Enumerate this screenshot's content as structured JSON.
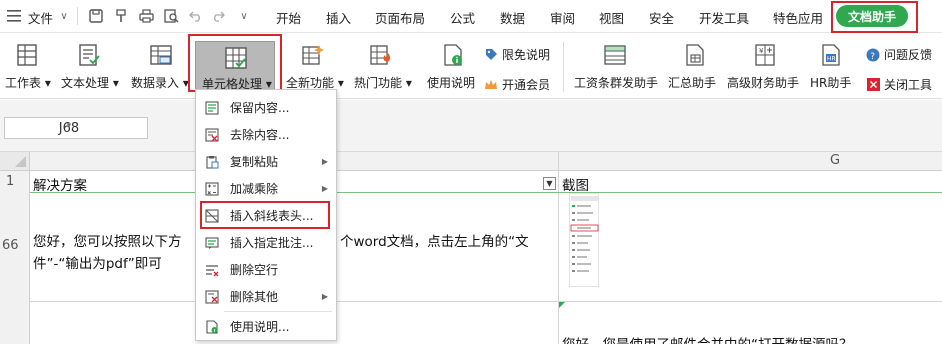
{
  "menubar": {
    "file_label": "文件",
    "tabs": [
      "开始",
      "插入",
      "页面布局",
      "公式",
      "数据",
      "审阅",
      "视图",
      "安全",
      "开发工具",
      "特色应用"
    ],
    "active_tab": "文档助手",
    "accent_color": "#2fa84f",
    "highlight_color": "#d9232d"
  },
  "ribbon": {
    "worksheet": "工作表",
    "text_processing": "文本处理",
    "data_entry": "数据录入",
    "cell_processing": "单元格处理",
    "all_features": "全新功能",
    "hot_features": "热门功能",
    "usage_guide": "使用说明",
    "disclaimer": "限免说明",
    "open_membership": "开通会员",
    "payroll_sender": "工资条群发助手",
    "summary_assistant": "汇总助手",
    "finance_assistant": "高级财务助手",
    "hr_assistant": "HR助手",
    "feedback": "问题反馈",
    "close_tool": "关闭工具"
  },
  "formula_bar": {
    "name_box": "J68"
  },
  "grid": {
    "col_g_header": "G",
    "row1_header": "1",
    "row66_header": "66",
    "a1": "解决方案",
    "g1": "截图",
    "a66_line1_left": "您好，您可以按照以下方",
    "a66_line1_right": "个word文档，点击左上角的“文",
    "a66_line2": "件”-“输出为pdf”即可",
    "g_next": "您好，您是使用了邮件合并中的“打开数据源吗？"
  },
  "dropdown": {
    "items": [
      {
        "label": "保留内容...",
        "submenu": false
      },
      {
        "label": "去除内容...",
        "submenu": false
      },
      {
        "label": "复制粘贴",
        "submenu": true
      },
      {
        "label": "加减乘除",
        "submenu": true
      },
      {
        "label": "插入斜线表头...",
        "submenu": false
      },
      {
        "label": "插入指定批注...",
        "submenu": false
      },
      {
        "label": "删除空行",
        "submenu": false
      },
      {
        "label": "删除其他",
        "submenu": true
      },
      {
        "label": "使用说明...",
        "submenu": false
      }
    ]
  }
}
